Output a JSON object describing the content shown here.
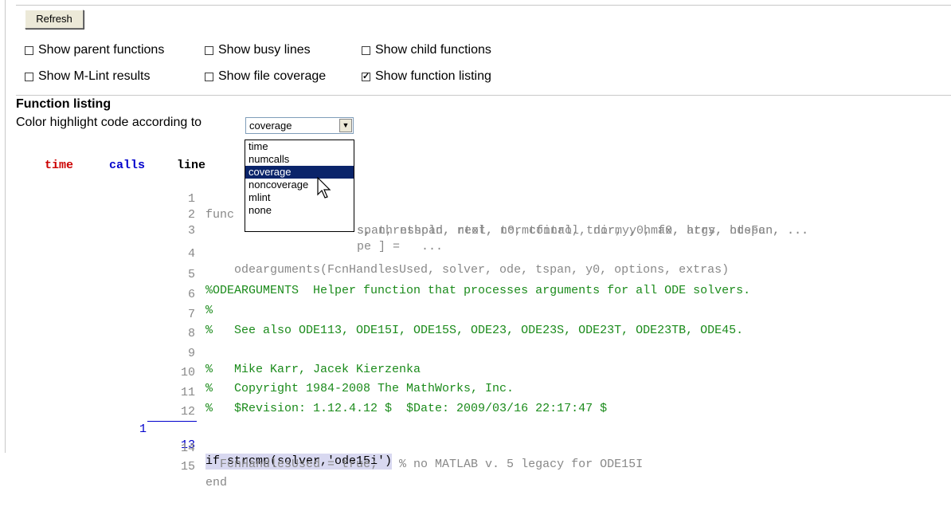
{
  "toolbar": {
    "refresh_label": "Refresh"
  },
  "options": {
    "parent": {
      "label": "Show parent functions",
      "checked": false
    },
    "busy": {
      "label": "Show busy lines",
      "checked": false
    },
    "child": {
      "label": "Show child functions",
      "checked": false
    },
    "mlint": {
      "label": "Show M-Lint results",
      "checked": false
    },
    "coverage": {
      "label": "Show file coverage",
      "checked": false
    },
    "listing": {
      "label": "Show function listing",
      "checked": true,
      "mark": "✓"
    }
  },
  "listing": {
    "heading": "Function listing",
    "color_label": "Color highlight code according to",
    "select_value": "coverage",
    "dropdown_options": [
      "time",
      "numcalls",
      "coverage",
      "noncoverage",
      "mlint",
      "none"
    ],
    "dropdown_selected": "coverage",
    "col_time": "time",
    "col_calls": "calls",
    "col_line": "line"
  },
  "code_lines": [
    {
      "n": "1",
      "text": "func",
      "tail": "span, ntspan, next, t0, tfinal, tdir, y0, f0, args, odeFcn, ..."
    },
    {
      "n": "2",
      "tail": "s, threshold, rtol, normcontrol, normy, hmax, htry, htspan, ..."
    },
    {
      "n": "3",
      "tail": "pe ] =   ..."
    },
    {
      "n": "4",
      "text": "    odearguments(FcnHandlesUsed, solver, ode, tspan, y0, options, extras)"
    },
    {
      "n": "5",
      "text": "%ODEARGUMENTS  Helper function that processes arguments for all ODE solvers."
    },
    {
      "n": "6",
      "text": "%"
    },
    {
      "n": "7",
      "text": "%   See also ODE113, ODE15I, ODE15S, ODE23, ODE23S, ODE23T, ODE23TB, ODE45."
    },
    {
      "n": "8",
      "text": ""
    },
    {
      "n": "9",
      "text": "%   Mike Karr, Jacek Kierzenka"
    },
    {
      "n": "10",
      "text": "%   Copyright 1984-2008 The MathWorks, Inc."
    },
    {
      "n": "11",
      "text": "%   $Revision: 1.12.4.12 $  $Date: 2009/03/16 22:17:47 $"
    },
    {
      "n": "12",
      "text": ""
    },
    {
      "n": "13",
      "calls": "1",
      "text": "if strcmp(solver,'ode15i')"
    },
    {
      "n": "14",
      "text": "  FcnHandlesUsed = true;   % no MATLAB v. 5 legacy for ODE15I"
    },
    {
      "n": "15",
      "text": "end"
    }
  ],
  "colors": {
    "time": "#cc0000",
    "calls": "#0000cc",
    "comment": "#1b8b1b",
    "uncovered": "#888888",
    "highlight": "#d8d8f0",
    "dropdown_selected": "#0a246a"
  }
}
